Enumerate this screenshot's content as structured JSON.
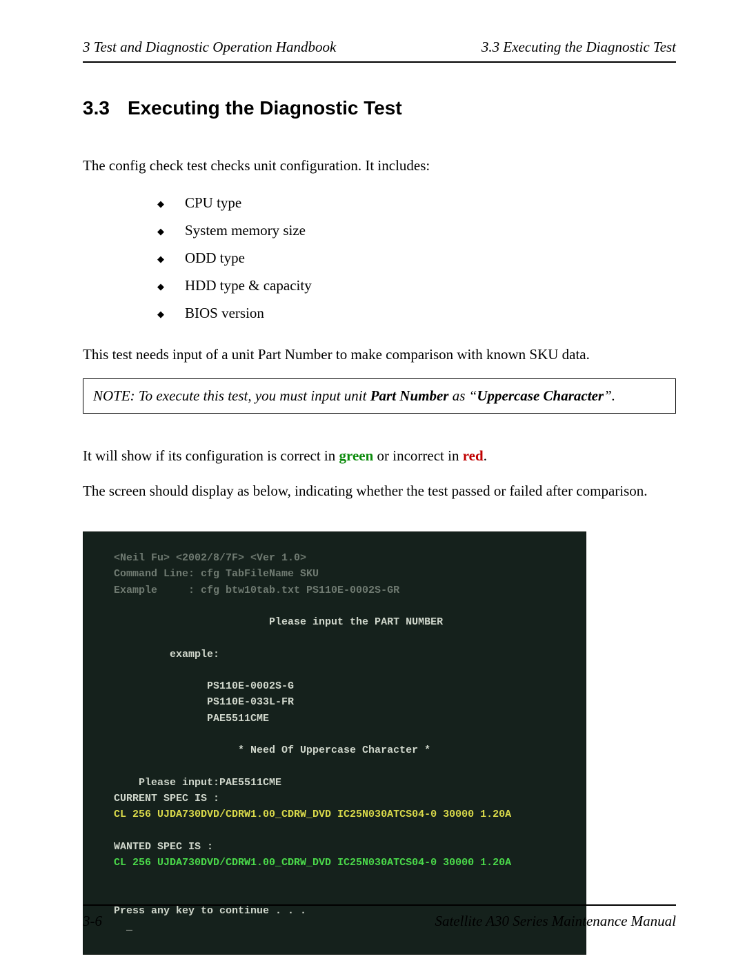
{
  "header": {
    "left": "3  Test and Diagnostic Operation Handbook",
    "right": "3.3  Executing the Diagnostic Test"
  },
  "heading": {
    "number": "3.3",
    "title": "Executing the Diagnostic Test"
  },
  "p_intro": "The config check test checks unit configuration. It includes:",
  "bullets": [
    "CPU type",
    "System memory size",
    "ODD type",
    "HDD type & capacity",
    "BIOS version"
  ],
  "p_sku": "This test needs input of a unit Part Number to make comparison with known SKU data.",
  "note": {
    "prefix": "NOTE:  To execute this test, you must input unit ",
    "bold1": "Part Number",
    "mid": " as “",
    "bold2": "Uppercase Character",
    "suffix": "”."
  },
  "p_colors": {
    "a": "It will show if its configuration is correct in ",
    "green": "green",
    "b": " or incorrect in ",
    "red": "red",
    "c": "."
  },
  "p_screen": "The screen should display as below, indicating whether the test passed or failed after comparison.",
  "screenshot": {
    "l1": "<Neil Fu> <2002/8/7F> <Ver 1.0>",
    "l2": "Command Line: cfg TabFileName SKU",
    "l3": "Example     : cfg btw10tab.txt PS110E-0002S-GR",
    "l4": "                         Please input the PART NUMBER",
    "l5": "         example:",
    "l6": "               PS110E-0002S-G",
    "l7": "               PS110E-033L-FR",
    "l8": "               PAE5511CME",
    "l9": "                    * Need Of Uppercase Character *",
    "l10": "    Please input:PAE5511CME",
    "l11": "CURRENT SPEC IS :",
    "l12": "CL 256 UJDA730DVD/CDRW1.00_CDRW_DVD IC25N030ATCS04-0 30000 1.20A",
    "l13": "WANTED SPEC IS :",
    "l14": "CL 256 UJDA730DVD/CDRW1.00_CDRW_DVD IC25N030ATCS04-0 30000 1.20A",
    "l15": "Press any key to continue . . .",
    "l16": "  _"
  },
  "footer": {
    "left": "3-6",
    "right": "Satellite A30 Series Maintenance Manual"
  }
}
